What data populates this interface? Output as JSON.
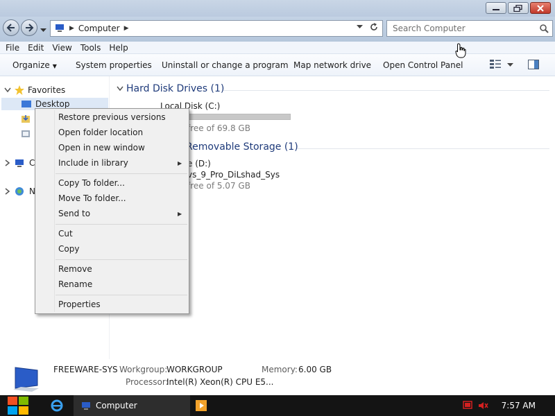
{
  "window": {
    "address": {
      "location": "Computer"
    },
    "search": {
      "placeholder": "Search Computer"
    }
  },
  "menubar": [
    "File",
    "Edit",
    "View",
    "Tools",
    "Help"
  ],
  "commandbar": {
    "organize": "Organize",
    "system_properties": "System properties",
    "uninstall": "Uninstall or change a program",
    "map_drive": "Map network drive",
    "control_panel": "Open Control Panel"
  },
  "navpane": {
    "favorites": "Favorites",
    "desktop": "Desktop",
    "computer_partial": "C",
    "network_partial": "N"
  },
  "content": {
    "hdd_group": "Hard Disk Drives (1)",
    "local_disk": {
      "name": "Local Disk (C:)",
      "free_partial": "free of 69.8 GB",
      "used_fraction": 0.16
    },
    "removable_group": "Removable Storage (1)",
    "removable": {
      "name_partial": "e (D:)",
      "label_partial": "vs_9_Pro_DiLshad_Sys",
      "free_partial": "free of 5.07 GB"
    }
  },
  "context_menu": {
    "items": [
      "Restore previous versions",
      "Open folder location",
      "Open in new window",
      "Include in library",
      "Copy To folder...",
      "Move To folder...",
      "Send to",
      "Cut",
      "Copy",
      "Remove",
      "Rename",
      "Properties"
    ]
  },
  "details": {
    "computer_name": "FREEWARE-SYS",
    "workgroup_label": "Workgroup:",
    "workgroup": "WORKGROUP",
    "memory_label": "Memory:",
    "memory": "6.00 GB",
    "processor_label": "Processor:",
    "processor": "Intel(R) Xeon(R) CPU E5..."
  },
  "taskbar": {
    "task_label": "Computer",
    "clock": "7:57 AM"
  },
  "colors": {
    "accent": "#26a0da",
    "group_heading": "#1e3a7a",
    "taskbar": "#141414"
  }
}
